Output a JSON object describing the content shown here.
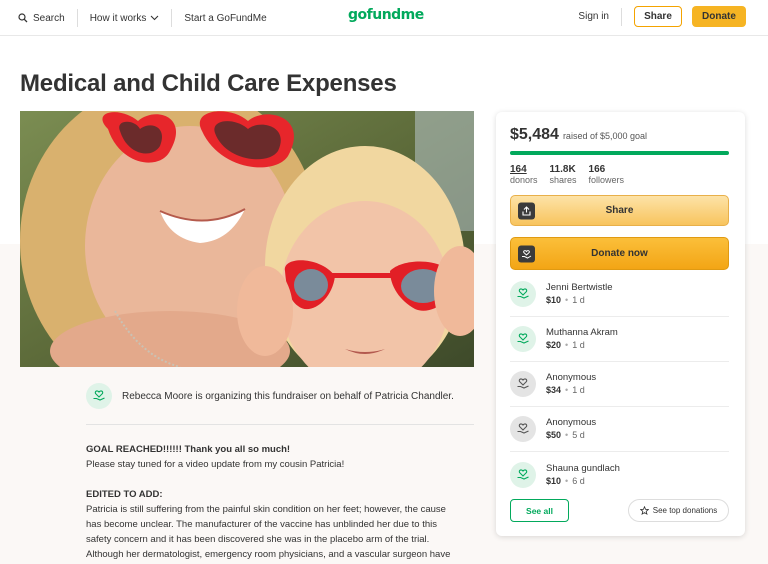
{
  "nav": {
    "search_label": "Search",
    "how_label": "How it works",
    "start_label": "Start a GoFundMe",
    "logo_text": "gofundme",
    "signin_label": "Sign in",
    "share_label": "Share",
    "donate_label": "Donate"
  },
  "page": {
    "title": "Medical and Child Care Expenses",
    "organizer_text": "Rebecca Moore is organizing this fundraiser on behalf of Patricia Chandler."
  },
  "story": {
    "line1": "GOAL REACHED!!!!!! Thank you all so much!",
    "line2": "Please stay tuned for a video update from my cousin Patricia!",
    "heading2": "EDITED TO ADD:",
    "line3": "Patricia is still suffering from the painful skin condition on her feet; however, the cause",
    "line4": "has become unclear.  The manufacturer of the vaccine has unblinded her due to this",
    "line5": "safety concern and it has been discovered she was in the placebo arm of the trial.",
    "line6": "Although her dermatologist, emergency room physicians, and a vascular surgeon have"
  },
  "card": {
    "raised_amount": "$5,484",
    "raised_of": "raised of $5,000 goal",
    "progress_fraction": 1.0,
    "progress_color": "#02a95c",
    "stats": [
      {
        "num": "164",
        "label": "donors"
      },
      {
        "num": "11.8K",
        "label": "shares"
      },
      {
        "num": "166",
        "label": "followers"
      }
    ],
    "share_label": "Share",
    "donate_label": "Donate now",
    "donations": [
      {
        "name": "Jenni Bertwistle",
        "amount": "$10",
        "ago": "1 d",
        "avatar": "green"
      },
      {
        "name": "Muthanna Akram",
        "amount": "$20",
        "ago": "1 d",
        "avatar": "green"
      },
      {
        "name": "Anonymous",
        "amount": "$34",
        "ago": "1 d",
        "avatar": "gray"
      },
      {
        "name": "Anonymous",
        "amount": "$50",
        "ago": "5 d",
        "avatar": "gray"
      },
      {
        "name": "Shauna gundlach",
        "amount": "$10",
        "ago": "6 d",
        "avatar": "green"
      }
    ],
    "see_all_label": "See all",
    "top_donations_label": "See top donations"
  },
  "colors": {
    "brand_green": "#02a95c",
    "donate_yellow": "#f6b423"
  },
  "icons": {
    "search": "search-icon",
    "chevron": "chevron-down-icon",
    "share": "share-icon",
    "donate": "donate-icon",
    "heart_hand": "heart-hand-icon",
    "star": "star-icon"
  }
}
